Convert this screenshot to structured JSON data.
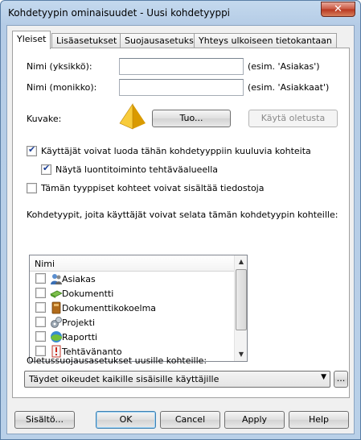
{
  "window": {
    "title": "Kohdetyypin ominaisuudet - Uusi kohdetyyppi",
    "close_glyph": "✕"
  },
  "tabs": [
    {
      "label": "Yleiset",
      "active": true
    },
    {
      "label": "Lisäasetukset"
    },
    {
      "label": "Suojausasetukset"
    },
    {
      "label": "Yhteys ulkoiseen tietokantaan"
    }
  ],
  "general": {
    "name_singular_label": "Nimi (yksikkö):",
    "name_singular_value": "",
    "name_singular_hint": "(esim. 'Asiakas')",
    "name_plural_label": "Nimi (monikko):",
    "name_plural_value": "",
    "name_plural_hint": "(esim. 'Asiakkaat')",
    "icon_label": "Kuvake:",
    "import_button": "Tuo...",
    "use_default_button": "Käytä oletusta",
    "allow_create_label": "Käyttäjät voivat luoda tähän kohdetyyppiin kuuluvia kohteita",
    "allow_create_checked": true,
    "show_in_taskbar_label": "Näytä luontitoiminto tehtäväalueella",
    "show_in_taskbar_checked": true,
    "allow_files_label": "Tämän tyyppiset kohteet voivat sisältää tiedostoja",
    "allow_files_checked": false,
    "browse_types_label": "Kohdetyypit, joita käyttäjät voivat selata tämän kohdetyypin kohteille:",
    "list_header": "Nimi",
    "object_types": [
      {
        "name": "Asiakas",
        "icon": "customer-icon",
        "checked": false
      },
      {
        "name": "Dokumentti",
        "icon": "document-icon",
        "checked": false
      },
      {
        "name": "Dokumenttikokoelma",
        "icon": "document-collection-icon",
        "checked": false
      },
      {
        "name": "Projekti",
        "icon": "project-icon",
        "checked": false
      },
      {
        "name": "Raportti",
        "icon": "report-icon",
        "checked": false
      },
      {
        "name": "Tehtävänanto",
        "icon": "assignment-icon",
        "checked": false
      }
    ],
    "default_security_label": "Oletussuojausasetukset uusille kohteille:",
    "default_security_value": "Täydet oikeudet kaikille sisäisille käyttäjille",
    "browse_button": "..."
  },
  "buttons": {
    "contents": "Sisältö...",
    "ok": "OK",
    "cancel": "Cancel",
    "apply": "Apply",
    "help": "Help"
  },
  "colors": {
    "title_bar": "#b9d0e8",
    "close_button": "#c8553f",
    "icon_yellow": "#f2b705",
    "checkmark": "#1c3f95"
  }
}
